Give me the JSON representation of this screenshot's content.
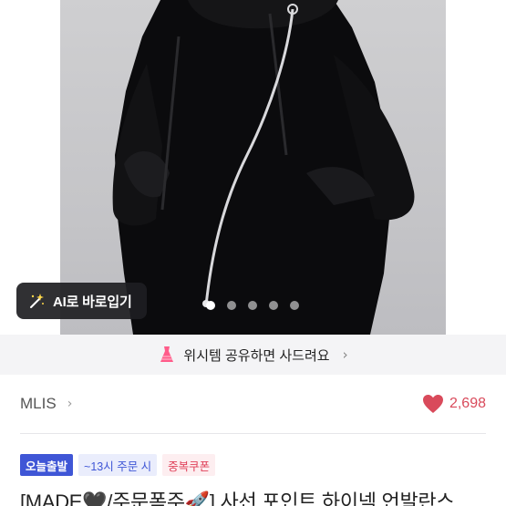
{
  "gallery": {
    "ai_button_label": "AI로 바로입기",
    "dots_count": 5,
    "active_index": 0
  },
  "wish_banner": {
    "label": "위시템 공유하면 사드려요"
  },
  "shop": {
    "name": "MLIS",
    "likes": "2,698"
  },
  "badges": [
    "오늘출발",
    "~13시 주문 시",
    "중복쿠폰"
  ],
  "product": {
    "title": "[MADE🖤/주문폭주🚀] 사선 포인트 하이넥 언발란스"
  },
  "colors": {
    "accent_blue": "#3f56d6",
    "heart_red": "#d94a5b",
    "coupon_red": "#e0415a"
  },
  "icons": {
    "wand": "magic-wand-icon",
    "dress": "dress-icon",
    "heart": "heart-icon",
    "chevron": "chevron-right-icon"
  }
}
